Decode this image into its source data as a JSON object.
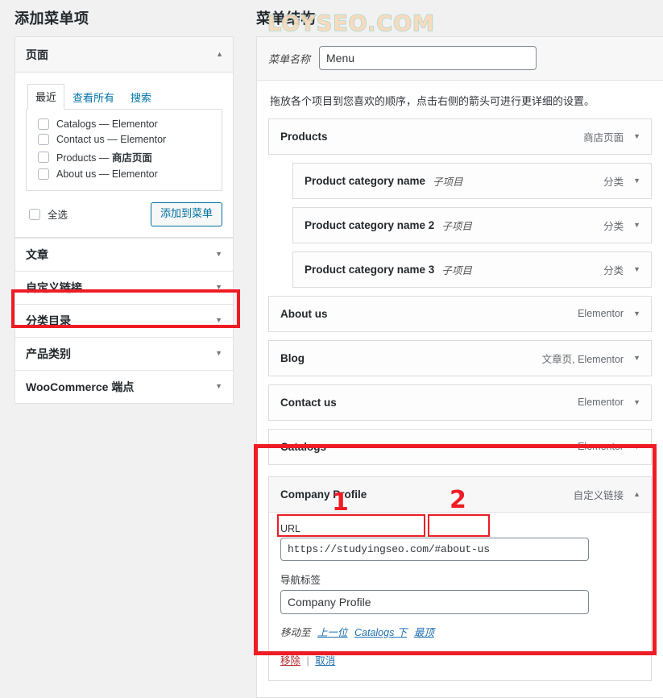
{
  "watermark": "LOYSEO.COM",
  "left_panel": {
    "heading": "添加菜单项",
    "pages_accordion": {
      "title": "页面",
      "collapse_icon": "▲",
      "tabs": [
        {
          "label": "最近",
          "active": true
        },
        {
          "label": "查看所有",
          "active": false
        },
        {
          "label": "搜索",
          "active": false
        }
      ],
      "items": [
        {
          "name": "Catalogs",
          "dash": "—",
          "type": "Elementor",
          "type_bold": false,
          "checked": false
        },
        {
          "name": "Contact us",
          "dash": "—",
          "type": "Elementor",
          "type_bold": false,
          "checked": false
        },
        {
          "name": "Products",
          "dash": "—",
          "type": "商店页面",
          "type_bold": true,
          "checked": false
        },
        {
          "name": "About us",
          "dash": "—",
          "type": "Elementor",
          "type_bold": false,
          "checked": false
        }
      ],
      "select_all_label": "全选",
      "add_to_menu_label": "添加到菜单"
    },
    "accordions": [
      {
        "title": "文章",
        "icon": "▼",
        "highlighted": false
      },
      {
        "title": "自定义链接",
        "icon": "▼",
        "highlighted": true
      },
      {
        "title": "分类目录",
        "icon": "▼",
        "highlighted": false
      },
      {
        "title": "产品类别",
        "icon": "▼",
        "highlighted": false
      },
      {
        "title": "WooCommerce 端点",
        "icon": "▼",
        "highlighted": false
      }
    ]
  },
  "right_panel": {
    "heading": "菜单结构",
    "menu_name_label": "菜单名称",
    "menu_name_value": "Menu",
    "menu_name_placeholder": "Menu",
    "instructions": "拖放各个项目到您喜欢的顺序，点击右侧的箭头可进行更详细的设置。",
    "menu_items": [
      {
        "title": "Products",
        "sub_label": "",
        "type": "商店页面",
        "arrow": "▼",
        "indent": 0
      },
      {
        "title": "Product category name",
        "sub_label": "子项目",
        "type": "分类",
        "arrow": "▼",
        "indent": 1
      },
      {
        "title": "Product category name 2",
        "sub_label": "子项目",
        "type": "分类",
        "arrow": "▼",
        "indent": 1
      },
      {
        "title": "Product category name 3",
        "sub_label": "子项目",
        "type": "分类",
        "arrow": "▼",
        "indent": 1
      },
      {
        "title": "About us",
        "sub_label": "",
        "type": "Elementor",
        "arrow": "▼",
        "indent": 0
      },
      {
        "title": "Blog",
        "sub_label": "",
        "type": "文章页, Elementor",
        "arrow": "▼",
        "indent": 0
      },
      {
        "title": "Contact us",
        "sub_label": "",
        "type": "Elementor",
        "arrow": "▼",
        "indent": 0
      },
      {
        "title": "Catalogs",
        "sub_label": "",
        "type": "Elementor",
        "arrow": "▼",
        "indent": 0
      }
    ],
    "expanded_item": {
      "title": "Company Profile",
      "type": "自定义链接",
      "arrow": "▲",
      "url_label": "URL",
      "url_value": "https://studyingseo.com/#about-us",
      "nav_label_label": "导航标签",
      "nav_label_value": "Company Profile",
      "move_label": "移动至",
      "move_links": [
        "上一位",
        "Catalogs 下",
        "最顶"
      ],
      "remove_label": "移除",
      "separator": "|",
      "cancel_label": "取消"
    }
  },
  "annotations": [
    {
      "number": "1",
      "target": "url-domain-part"
    },
    {
      "number": "2",
      "target": "url-anchor-part"
    }
  ],
  "colors": {
    "annotation_red": "#ee1c25",
    "link_blue": "#2271b1",
    "remove_red": "#b32d2e",
    "page_bg": "#f1f1f1"
  }
}
